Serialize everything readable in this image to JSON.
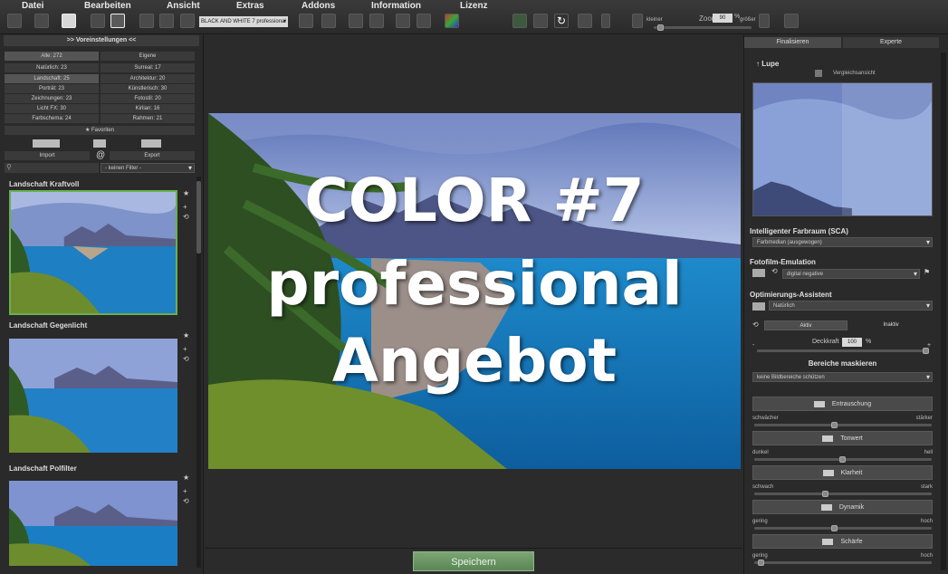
{
  "menu": [
    "Datei",
    "Bearbeiten",
    "Ansicht",
    "Extras",
    "Addons",
    "Information",
    "Lizenz"
  ],
  "toolbar": {
    "preset_select": "BLACK AND WHITE 7 professional",
    "zoom_small": "kleiner",
    "zoom_label": "Zoom",
    "zoom_value": "90",
    "zoom_unit": "%",
    "zoom_large": "größer"
  },
  "left": {
    "header": ">> Voreinstellungen <<",
    "categories": [
      [
        "Alle: 272",
        "Eigene"
      ],
      [
        "Natürlich: 23",
        "Surreal: 17"
      ],
      [
        "Landschaft: 25",
        "Architektur: 20"
      ],
      [
        "Porträt: 23",
        "Künstlerisch: 30"
      ],
      [
        "Zeichnungen: 23",
        "Fotostil: 20"
      ],
      [
        "Licht FX: 30",
        "Kirlian: 16"
      ],
      [
        "Farbschema: 24",
        "Rahmen: 21"
      ]
    ],
    "favorites": "Favoriten",
    "import": "Import",
    "export": "Export",
    "filter": "- keinen Filter -",
    "presets": [
      "Landschaft Kraftvoll",
      "Landschaft Gegenlicht",
      "Landschaft Polfilter"
    ]
  },
  "overlay": {
    "line1": "COLOR #7",
    "line2": "professional",
    "line3": "Angebot"
  },
  "save": "Speichern",
  "right": {
    "tab_finish": "Finalisieren",
    "tab_expert": "Experte",
    "lupe": "Lupe",
    "compare": "Vergleichsansicht",
    "sca_title": "Intelligenter Farbraum (SCA)",
    "sca_value": "Farbmedian (ausgewogen)",
    "film_title": "Fotofilm-Emulation",
    "film_value": "digital negative",
    "opt_title": "Optimierungs-Assistent",
    "opt_value": "Natürlich",
    "active": "Aktiv",
    "inactive": "Inaktiv",
    "opacity_label": "Deckkraft",
    "opacity_value": "100",
    "opacity_unit": "%",
    "mask_title": "Bereiche maskieren",
    "mask_value": "keine Bildbereiche schützen",
    "sliders": [
      {
        "name": "Entrauschung",
        "left": "schwächer",
        "right": "stärker",
        "level": 0.45
      },
      {
        "name": "Tonwert",
        "left": "dunkel",
        "right": "hell",
        "level": 0.5
      },
      {
        "name": "Klarheit",
        "left": "schwach",
        "right": "stark",
        "level": 0.4
      },
      {
        "name": "Dynamik",
        "left": "gering",
        "right": "hoch",
        "level": 0.45
      },
      {
        "name": "Schärfe",
        "left": "gering",
        "right": "hoch",
        "level": 0.02
      }
    ]
  }
}
